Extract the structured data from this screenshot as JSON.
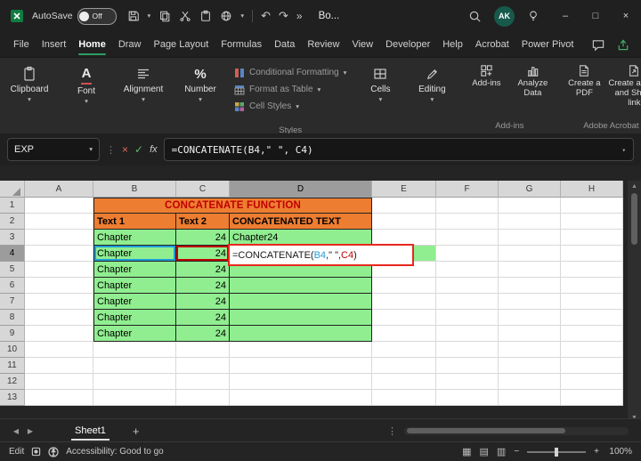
{
  "window": {
    "title": "Bo...",
    "avatar_initials": "AK"
  },
  "titlebar": {
    "autosave_label": "AutoSave",
    "autosave_state": "Off"
  },
  "menubar": {
    "items": [
      "File",
      "Insert",
      "Home",
      "Draw",
      "Page Layout",
      "Formulas",
      "Data",
      "Review",
      "View",
      "Developer",
      "Help",
      "Acrobat",
      "Power Pivot"
    ],
    "active_index": 2
  },
  "ribbon": {
    "big_buttons": [
      "Clipboard",
      "Font",
      "Alignment",
      "Number"
    ],
    "styles_menu": [
      "Conditional Formatting",
      "Format as Table",
      "Cell Styles"
    ],
    "cells_button": "Cells",
    "editing_button": "Editing",
    "addins_buttons": [
      "Add-ins",
      "Analyze Data"
    ],
    "acrobat_buttons": [
      "Create a PDF",
      "Create a PDF and Share link"
    ],
    "group_labels": {
      "styles": "Styles",
      "addins": "Add-ins",
      "acrobat": "Adobe Acrobat"
    }
  },
  "formula_bar": {
    "name_box": "EXP",
    "fx_label": "fx",
    "formula": "=CONCATENATE(B4,\" \", C4)"
  },
  "grid": {
    "columns": [
      "A",
      "B",
      "C",
      "D",
      "E",
      "F",
      "G",
      "H"
    ],
    "row_count": 13,
    "active_col": "D",
    "active_row": 4,
    "title": {
      "text": "CONCATENATE FUNCTION"
    },
    "table_headers": {
      "B": "Text 1",
      "C": "Text 2",
      "D": "CONCATENATED TEXT"
    },
    "rows": [
      {
        "r": 3,
        "B": "Chapter",
        "C": "24",
        "D": "Chapter24"
      },
      {
        "r": 4,
        "B": "Chapter",
        "C": "24",
        "D": "=CONCATENATE(B4,\" \", C4)"
      },
      {
        "r": 5,
        "B": "Chapter",
        "C": "24",
        "D": ""
      },
      {
        "r": 6,
        "B": "Chapter",
        "C": "24",
        "D": ""
      },
      {
        "r": 7,
        "B": "Chapter",
        "C": "24",
        "D": ""
      },
      {
        "r": 8,
        "B": "Chapter",
        "C": "24",
        "D": ""
      },
      {
        "r": 9,
        "B": "Chapter",
        "C": "24",
        "D": ""
      }
    ],
    "formula_parts": [
      {
        "text": "=CONCATENATE(",
        "color": "#1a1a1a"
      },
      {
        "text": "B4",
        "color": "#1f9cd8"
      },
      {
        "text": ",\" \", ",
        "color": "#1a1a1a"
      },
      {
        "text": "C4",
        "color": "#c00000"
      },
      {
        "text": ")",
        "color": "#1a1a1a"
      }
    ]
  },
  "sheet_bar": {
    "tabs": [
      "Sheet1"
    ],
    "active": "Sheet1"
  },
  "status_bar": {
    "mode": "Edit",
    "accessibility": "Accessibility: Good to go",
    "zoom": "100%"
  },
  "icons": {
    "dropdown": "▾",
    "undo": "↶",
    "redo": "↷",
    "more_commands": "»",
    "minimize": "–",
    "maximize": "□",
    "close": "×",
    "cancel": "×",
    "enter": "✓",
    "vertical_dots": "⋮",
    "tab_prev": "◀",
    "tab_next": "▶",
    "new_sheet": "+",
    "scroll_up": "▲",
    "scroll_down": "▼",
    "view_normal": "▦",
    "view_layout": "▤",
    "view_break": "▥",
    "zoom_out": "−",
    "zoom_in": "+",
    "percent": "%",
    "font_letter": "A"
  },
  "colors": {
    "accent_green": "#107C41",
    "table_orange": "#ED7D31",
    "table_green": "#90EE90",
    "title_red": "#C00000",
    "ref_blue": "#1f9cd8",
    "ref_red": "#C00000",
    "annotation_red": "#E8281E"
  }
}
